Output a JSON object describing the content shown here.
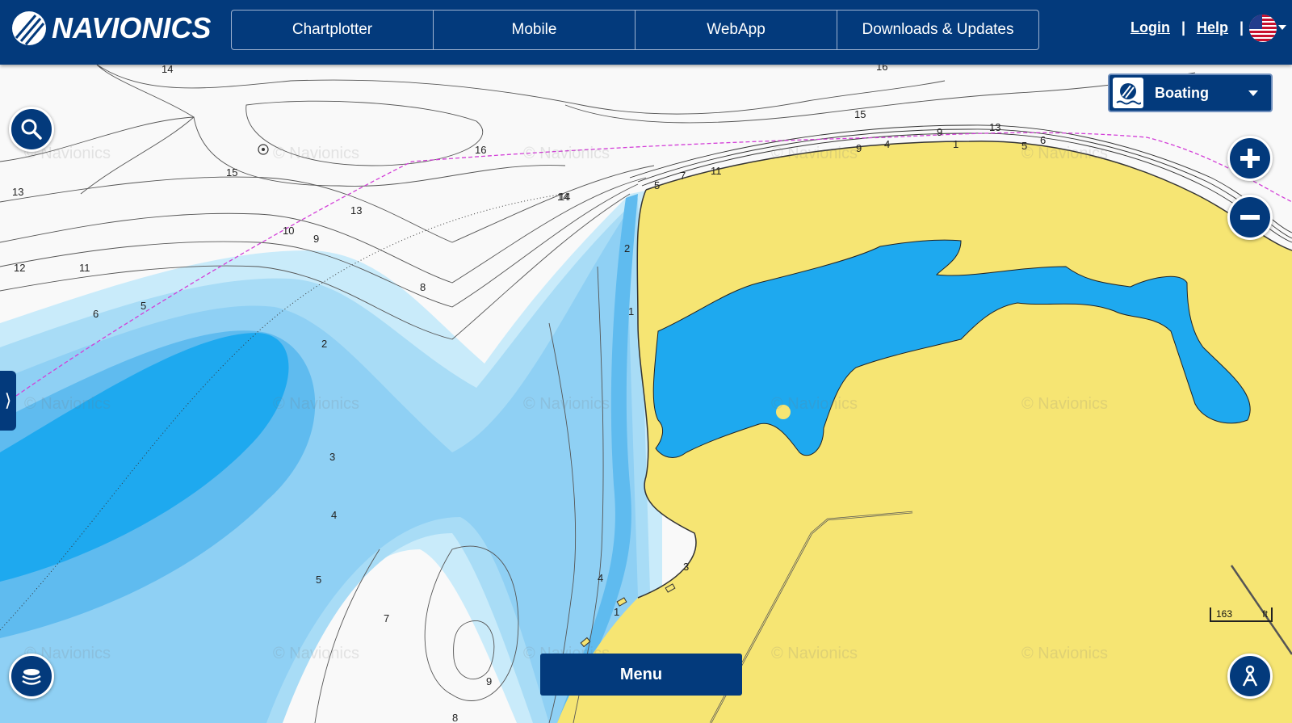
{
  "header": {
    "logo_text": "NAVIONICS",
    "nav_tabs": [
      "Chartplotter",
      "Mobile",
      "WebApp",
      "Downloads & Updates"
    ],
    "login_label": "Login",
    "help_label": "Help",
    "separator": "|",
    "language_flag_icon": "us-flag-icon"
  },
  "mode_selector": {
    "selected": "Boating",
    "icon": "navionics-boating-icon"
  },
  "controls": {
    "search_icon": "search-icon",
    "zoom_in_icon": "plus-icon",
    "zoom_out_icon": "minus-icon",
    "layers_icon": "layers-icon",
    "route_icon": "route-icon",
    "side_panel_icon": "chevron-right-icon"
  },
  "menu_button_label": "Menu",
  "scale": {
    "value": "163",
    "unit": "ft"
  },
  "watermark": "© Navionics",
  "depth_labels": [
    "14",
    "16",
    "15",
    "14",
    "16",
    "15",
    "13",
    "13",
    "14",
    "10",
    "9",
    "12",
    "11",
    "6",
    "5",
    "8",
    "2",
    "1",
    "2",
    "3",
    "4",
    "5",
    "7",
    "4",
    "1",
    "3",
    "9",
    "8",
    "5",
    "7",
    "11",
    "9",
    "4",
    "1",
    "13",
    "6",
    "9",
    "5"
  ],
  "colors": {
    "header_bg": "#033a7c",
    "land": "#f6e573",
    "deep_water": "#1ea9ef",
    "shallow_water": "#a3dbf5",
    "open_water": "#f9f9f9",
    "route_line": "#d33fd8"
  }
}
